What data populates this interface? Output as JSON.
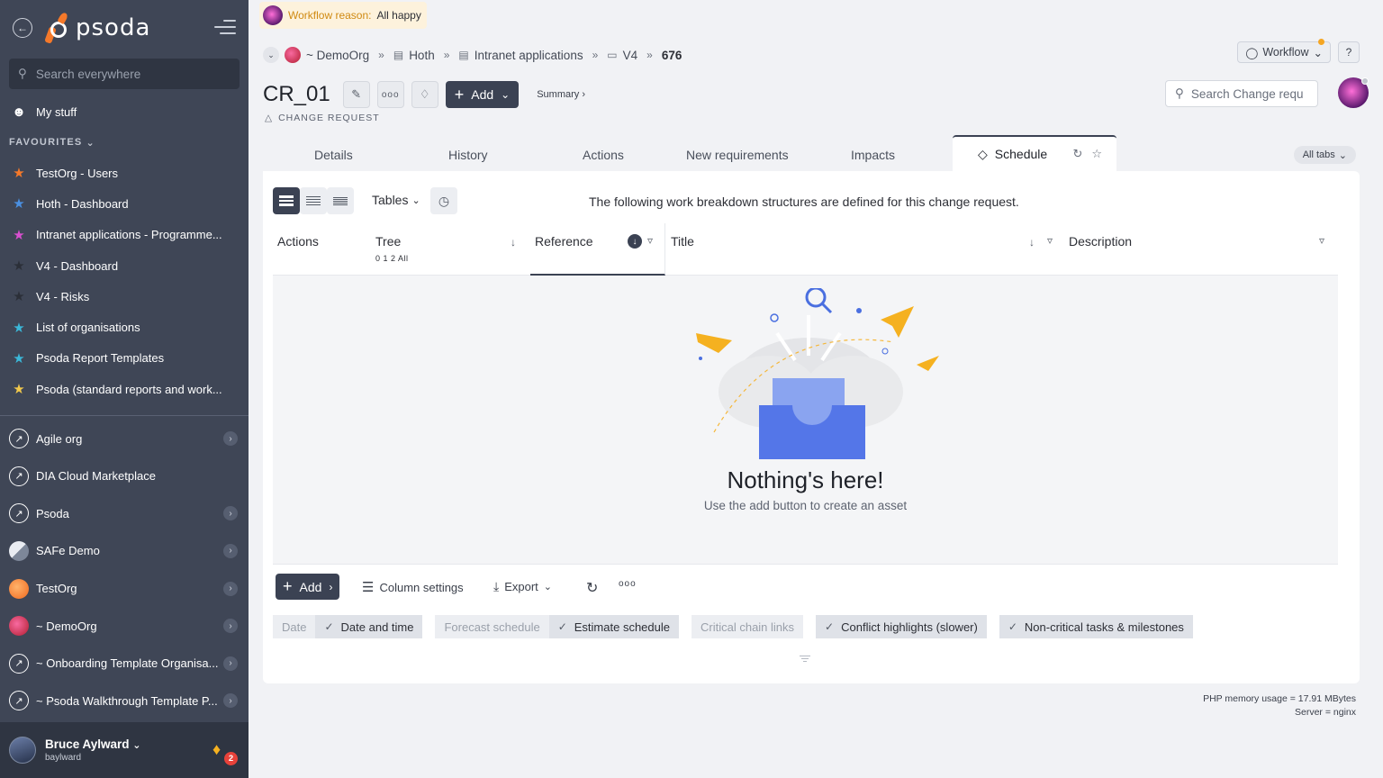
{
  "sidebar": {
    "search_placeholder": "Search everywhere",
    "my_stuff": "My stuff",
    "favourites_header": "FAVOURITES",
    "favourites": [
      {
        "label": "TestOrg - Users",
        "color": "#f5792a"
      },
      {
        "label": "Hoth - Dashboard",
        "color": "#4a90e2"
      },
      {
        "label": "Intranet applications - Programme...",
        "color": "#d94fd0"
      },
      {
        "label": "V4 - Dashboard",
        "color": "#2b2f38"
      },
      {
        "label": "V4 - Risks",
        "color": "#2b2f38"
      },
      {
        "label": "List of organisations",
        "color": "#3bb8d9"
      },
      {
        "label": "Psoda Report Templates",
        "color": "#3bb8d9"
      },
      {
        "label": "Psoda (standard reports and work...",
        "color": "#f2c94c"
      }
    ],
    "orgs": [
      {
        "label": "Agile org",
        "icon": "rocket-icon",
        "chevron": true
      },
      {
        "label": "DIA Cloud Marketplace",
        "icon": "rocket-icon",
        "chevron": false
      },
      {
        "label": "Psoda",
        "icon": "rocket-icon",
        "chevron": true
      },
      {
        "label": "SAFe Demo",
        "icon": "safe-icon",
        "chevron": true
      },
      {
        "label": "TestOrg",
        "icon": "testorg-icon",
        "chevron": true
      },
      {
        "label": "~ DemoOrg",
        "icon": "demoorg-icon",
        "chevron": true
      },
      {
        "label": "~ Onboarding Template Organisa...",
        "icon": "rocket-icon",
        "chevron": true
      },
      {
        "label": "~ Psoda Walkthrough Template P...",
        "icon": "rocket-icon",
        "chevron": true
      }
    ],
    "user": {
      "name": "Bruce Aylward",
      "handle": "baylward",
      "notifications": "2"
    }
  },
  "logo_text": "psoda",
  "workflow_reason": {
    "label": "Workflow reason:",
    "value": "All happy"
  },
  "breadcrumb": {
    "org": "~ DemoOrg",
    "items": [
      "Hoth",
      "Intranet applications",
      "V4"
    ],
    "last": "676"
  },
  "top_right": {
    "workflow_label": "Workflow",
    "help": "?"
  },
  "title": {
    "name": "CR_01",
    "type": "CHANGE REQUEST",
    "add_label": "Add",
    "summary": "Summary"
  },
  "search_cr_placeholder": "Search Change requ",
  "tabs": [
    "Details",
    "History",
    "Actions",
    "New requirements",
    "Impacts"
  ],
  "active_tab": "Schedule",
  "all_tabs": "All tabs",
  "panel": {
    "tables_label": "Tables",
    "intro": "The following work breakdown structures are defined for this change request.",
    "columns": {
      "actions": "Actions",
      "tree": "Tree",
      "tree_levels": "0 1 2 All",
      "reference": "Reference",
      "title": "Title",
      "description": "Description"
    },
    "empty_title": "Nothing's here!",
    "empty_sub": "Use the add button to create an asset"
  },
  "toolbar": {
    "add": "Add",
    "column_settings": "Column settings",
    "export": "Export"
  },
  "chips": [
    [
      {
        "label": "Date",
        "on": false
      },
      {
        "label": "Date and time",
        "on": true
      }
    ],
    [
      {
        "label": "Forecast schedule",
        "on": false
      },
      {
        "label": "Estimate schedule",
        "on": true
      }
    ],
    [
      {
        "label": "Critical chain links",
        "on": false
      }
    ],
    [
      {
        "label": "Conflict highlights (slower)",
        "on": true
      }
    ],
    [
      {
        "label": "Non-critical tasks & milestones",
        "on": true
      }
    ]
  ],
  "footer": {
    "memory": "PHP memory usage = 17.91 MBytes",
    "server": "Server = nginx"
  }
}
